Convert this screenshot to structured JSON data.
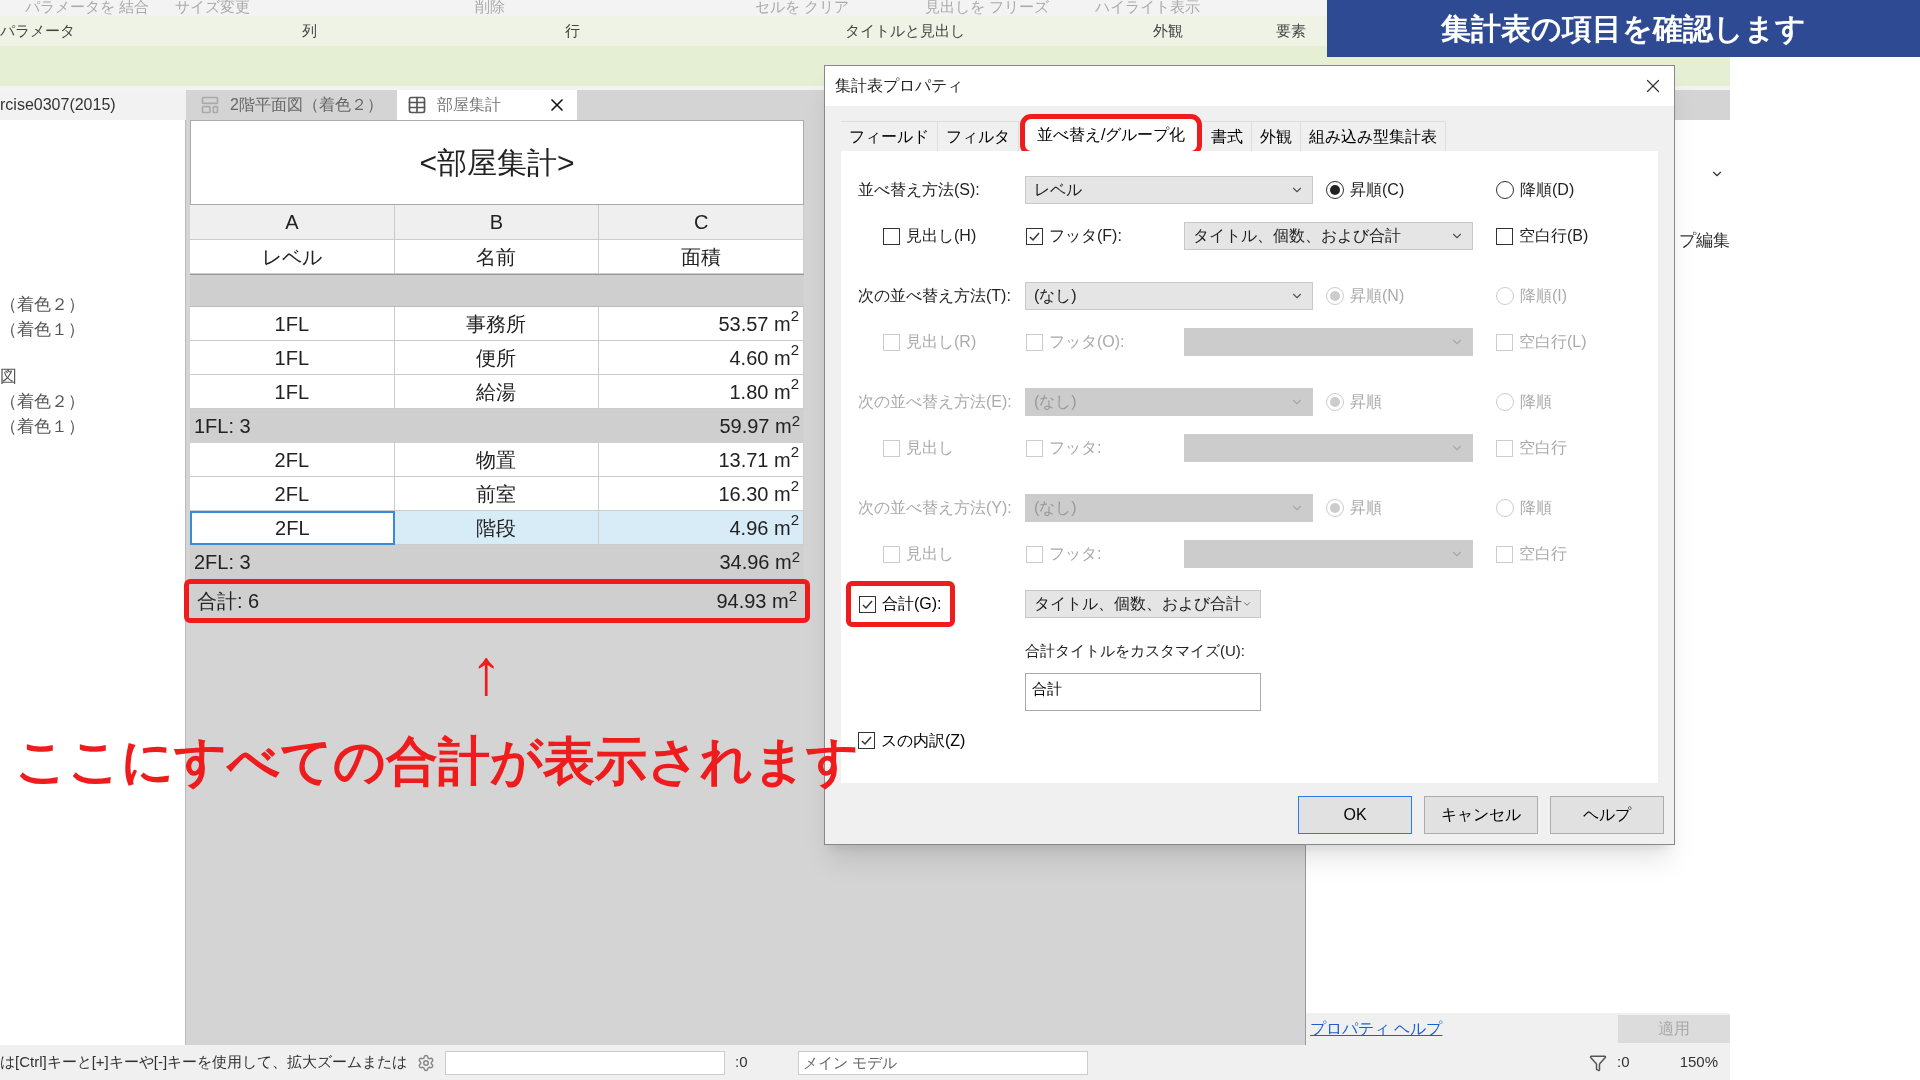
{
  "banner": "集計表の項目を確認します",
  "ribbon": {
    "tools": [
      "パラメータを 結合",
      "サイズ変更",
      "削除",
      "セルを クリア",
      "見出しを フリーズ",
      "ハイライト表示"
    ],
    "panels": [
      "パラメータ",
      "列",
      "行",
      "タイトルと見出し",
      "外観",
      "要素"
    ]
  },
  "project_browser": {
    "title": "rcise0307(2015)",
    "groups": [
      [
        "（着色２）",
        "（着色１）"
      ],
      [
        "図",
        "（着色２）",
        "（着色１）"
      ]
    ]
  },
  "view_tabs": [
    {
      "label": "2階平面図（着色２）",
      "kind": "plan",
      "selected": false
    },
    {
      "label": "部屋集計",
      "kind": "schedule",
      "selected": true
    }
  ],
  "schedule": {
    "title": "<部屋集計>",
    "column_letters": [
      "A",
      "B",
      "C"
    ],
    "headers": [
      "レベル",
      "名前",
      "面積"
    ],
    "rows": [
      {
        "kind": "blank"
      },
      {
        "kind": "data",
        "cells": [
          "1FL",
          "事務所",
          "53.57 m$^{2}$"
        ],
        "selected": false
      },
      {
        "kind": "data",
        "cells": [
          "1FL",
          "便所",
          "4.60 m$^{2}$"
        ],
        "selected": false
      },
      {
        "kind": "data",
        "cells": [
          "1FL",
          "給湯",
          "1.80 m$^{2}$"
        ],
        "selected": false
      },
      {
        "kind": "subtotal",
        "label": "1FL: 3",
        "value": "59.97 m$^{2}$",
        "highlighted": false
      },
      {
        "kind": "data",
        "cells": [
          "2FL",
          "物置",
          "13.71 m$^{2}$"
        ],
        "selected": false
      },
      {
        "kind": "data",
        "cells": [
          "2FL",
          "前室",
          "16.30 m$^{2}$"
        ],
        "selected": false
      },
      {
        "kind": "data",
        "cells": [
          "2FL",
          "階段",
          "4.96 m$^{2}$"
        ],
        "selected": true
      },
      {
        "kind": "subtotal",
        "label": "2FL: 3",
        "value": "34.96 m$^{2}$",
        "highlighted": false
      },
      {
        "kind": "subtotal",
        "label": "合計: 6",
        "value": "94.93 m$^{2}$",
        "highlighted": true
      }
    ]
  },
  "annotation": {
    "arrow": "↑",
    "callout": "ここにすべての合計が表示されます"
  },
  "dialog": {
    "title": "集計表プロパティ",
    "tabs": [
      {
        "label": "フィールド",
        "selected": false,
        "highlighted": false
      },
      {
        "label": "フィルタ",
        "selected": false,
        "highlighted": false
      },
      {
        "label": "並べ替え/グループ化",
        "selected": true,
        "highlighted": true
      },
      {
        "label": "書式",
        "selected": false,
        "highlighted": false
      },
      {
        "label": "外観",
        "selected": false,
        "highlighted": false
      },
      {
        "label": "組み込み型集計表",
        "selected": false,
        "highlighted": false
      }
    ],
    "sort_levels": [
      {
        "label": "並べ替え方法(S):",
        "field": "レベル",
        "field_enabled": true,
        "options_enabled": true,
        "order": [
          {
            "label": "昇順(C)",
            "selected": true
          },
          {
            "label": "降順(D)",
            "selected": false
          }
        ],
        "checks": [
          {
            "label": "見出し(H)",
            "checked": false
          },
          {
            "label": "フッタ(F):",
            "checked": true
          }
        ],
        "footer_option": "タイトル、個数、および合計",
        "blank_line": {
          "label": "空白行(B)",
          "checked": false
        }
      },
      {
        "label": "次の並べ替え方法(T):",
        "field": "(なし)",
        "field_enabled": true,
        "options_enabled": false,
        "order": [
          {
            "label": "昇順(N)",
            "selected": true
          },
          {
            "label": "降順(I)",
            "selected": false
          }
        ],
        "checks": [
          {
            "label": "見出し(R)",
            "checked": false
          },
          {
            "label": "フッタ(O):",
            "checked": false
          }
        ],
        "blank_line": {
          "label": "空白行(L)",
          "checked": false
        }
      },
      {
        "label": "次の並べ替え方法(E):",
        "field": "(なし)",
        "field_enabled": false,
        "options_enabled": false,
        "order": [
          {
            "label": "昇順",
            "selected": true
          },
          {
            "label": "降順",
            "selected": false
          }
        ],
        "checks": [
          {
            "label": "見出し",
            "checked": false
          },
          {
            "label": "フッタ:",
            "checked": false
          }
        ],
        "blank_line": {
          "label": "空白行",
          "checked": false
        }
      },
      {
        "label": "次の並べ替え方法(Y):",
        "field": "(なし)",
        "field_enabled": false,
        "options_enabled": false,
        "order": [
          {
            "label": "昇順",
            "selected": true
          },
          {
            "label": "降順",
            "selected": false
          }
        ],
        "checks": [
          {
            "label": "見出し",
            "checked": false
          },
          {
            "label": "フッタ:",
            "checked": false
          }
        ],
        "blank_line": {
          "label": "空白行",
          "checked": false
        }
      }
    ],
    "grand_total": {
      "label": "合計(G):",
      "checked": true,
      "highlighted": true,
      "option": "タイトル、個数、および合計"
    },
    "custom_title": {
      "label": "合計タイトルをカスタマイズ(U):",
      "value": "合計"
    },
    "itemize": {
      "label": "スの内訳(Z)",
      "checked": true
    },
    "buttons": [
      {
        "label": "OK",
        "default": true
      },
      {
        "label": "キャンセル",
        "default": false
      },
      {
        "label": "ヘルプ",
        "default": false
      }
    ]
  },
  "properties": {
    "edit_type": "プ編集",
    "help_link": "プロパティ ヘルプ",
    "apply": {
      "label": "適用",
      "disabled": true
    }
  },
  "status_bar": {
    "hint": "は[Ctrl]キーと[+]キーや[-]キーを使用して、拡大ズームまたは",
    "count": ":0",
    "model": "メイン モデル",
    "filter_count": ":0",
    "zoom": "150%"
  }
}
